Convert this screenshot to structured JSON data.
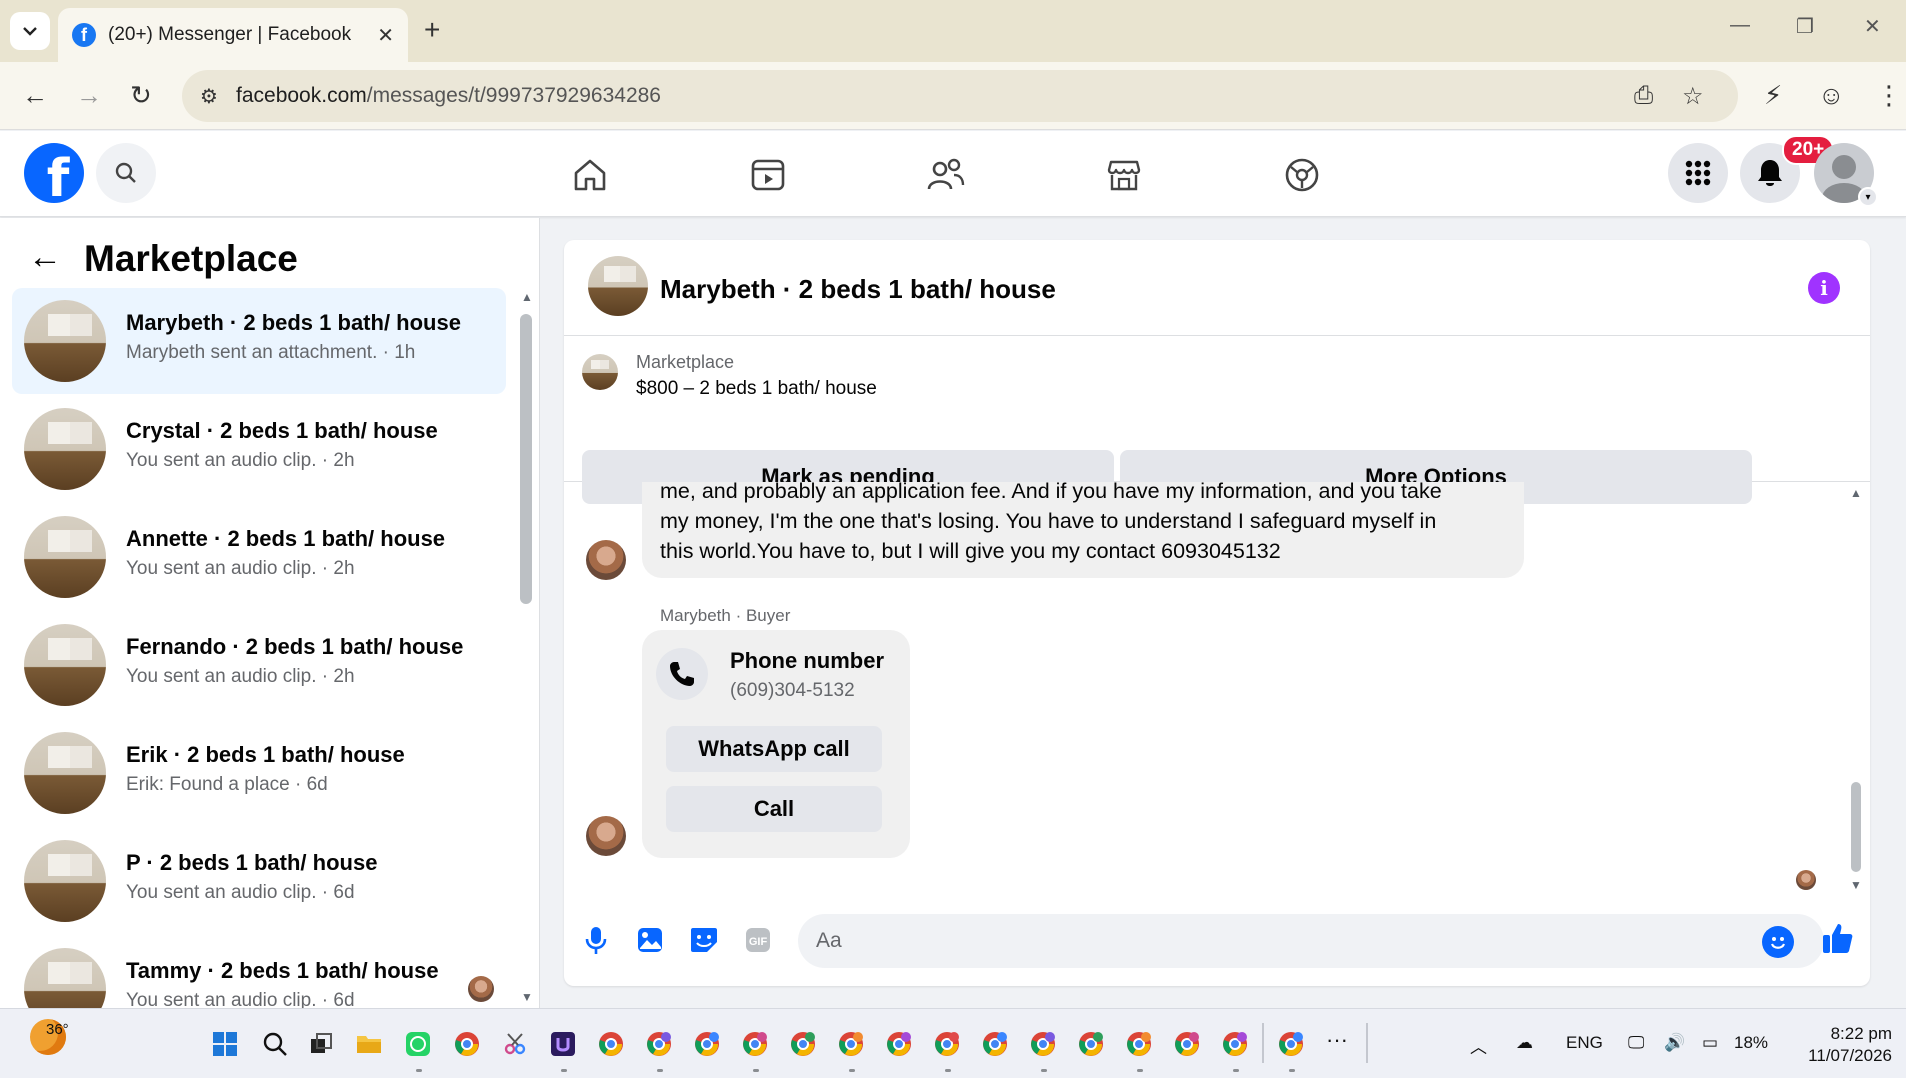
{
  "browser": {
    "tab_title": "(20+) Messenger | Facebook",
    "url_host": "facebook.com",
    "url_path": "/messages/t/999737929634286",
    "new_tab": "+",
    "tab_close": "✕"
  },
  "fb_header": {
    "notification_badge": "20+"
  },
  "sidebar": {
    "title": "Marketplace",
    "conversations": [
      {
        "name": "Marybeth · 2 beds 1 bath/ house",
        "preview": "Marybeth sent an attachment. · 1h",
        "active": true
      },
      {
        "name": "Crystal · 2 beds 1 bath/ house",
        "preview": "You sent an audio clip. · 2h"
      },
      {
        "name": "Annette · 2 beds 1 bath/ house",
        "preview": "You sent an audio clip. · 2h"
      },
      {
        "name": "Fernando · 2 beds 1 bath/ house",
        "preview": "You sent an audio clip. · 2h"
      },
      {
        "name": "Erik · 2 beds 1 bath/ house",
        "preview": "Erik: Found a place · 6d"
      },
      {
        "name": "P · 2 beds 1 bath/ house",
        "preview": "You sent an audio clip. · 6d"
      },
      {
        "name": "Tammy · 2 beds 1 bath/ house",
        "preview": "You sent an audio clip. · 6d"
      }
    ]
  },
  "chat": {
    "title": "Marybeth · 2 beds 1 bath/ house",
    "listing_category": "Marketplace",
    "listing_title": "$800 – 2 beds 1 bath/ house",
    "mark_pending": "Mark as pending",
    "more_options": "More Options",
    "message_text": "yo , ... me, and probably an application fee. And if you have my information, and you take my money, I'm the one that's losing. You have to understand I safeguard myself in this world.You have to, but I will give you my contact 6093045132",
    "message_lines": [
      "me, and probably an application fee. And if you have my information, and you take",
      "my money, I'm the one that's losing. You have to understand I safeguard myself in",
      "this world.You have to, but I will give you my contact 6093045132"
    ],
    "sender_label": "Marybeth · Buyer",
    "contact_title": "Phone number",
    "contact_number": "(609)304-5132",
    "whatsapp_call": "WhatsApp call",
    "call": "Call",
    "input_placeholder": "Aa"
  },
  "taskbar": {
    "temperature": "36°",
    "language": "ENG",
    "battery": "18%",
    "time": "8:22 pm",
    "date": "11/07/2026",
    "more": "···"
  },
  "colors": {
    "fb_blue": "#0866ff",
    "badge_red": "#e41e3f",
    "info_purple": "#a033ff",
    "active_row": "#ebf5ff"
  }
}
